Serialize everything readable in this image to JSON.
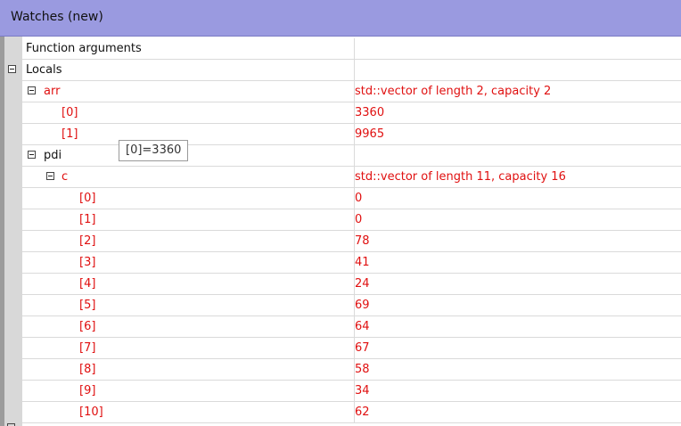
{
  "window": {
    "title": "Watches (new)"
  },
  "rows": [
    {
      "name": "Function arguments",
      "value": "",
      "color": "#111111"
    },
    {
      "name": "Locals",
      "value": "",
      "color": "#111111",
      "expanded": true
    },
    {
      "name": "arr",
      "value": "std::vector of length 2, capacity 2",
      "color": "#e01010",
      "expanded": true
    },
    {
      "name": "[0]",
      "value": "3360",
      "color": "#e01010"
    },
    {
      "name": "[1]",
      "value": "9965",
      "color": "#e01010"
    },
    {
      "name": "pdi",
      "value": "",
      "color": "#111111",
      "expanded": true
    },
    {
      "name": "c",
      "value": "std::vector of length 11, capacity 16",
      "color": "#e01010",
      "expanded": true
    },
    {
      "name": "[0]",
      "value": "0",
      "color": "#e01010"
    },
    {
      "name": "[1]",
      "value": "0",
      "color": "#e01010"
    },
    {
      "name": "[2]",
      "value": "78",
      "color": "#e01010"
    },
    {
      "name": "[3]",
      "value": "41",
      "color": "#e01010"
    },
    {
      "name": "[4]",
      "value": "24",
      "color": "#e01010"
    },
    {
      "name": "[5]",
      "value": "69",
      "color": "#e01010"
    },
    {
      "name": "[6]",
      "value": "64",
      "color": "#e01010"
    },
    {
      "name": "[7]",
      "value": "67",
      "color": "#e01010"
    },
    {
      "name": "[8]",
      "value": "58",
      "color": "#e01010"
    },
    {
      "name": "[9]",
      "value": "34",
      "color": "#e01010"
    },
    {
      "name": "[10]",
      "value": "62",
      "color": "#e01010"
    }
  ],
  "tooltip": {
    "text": "[0]=3360"
  },
  "colors": {
    "title_bar": "#9a9ae0",
    "changed_value": "#e01010",
    "normal_text": "#111111"
  }
}
